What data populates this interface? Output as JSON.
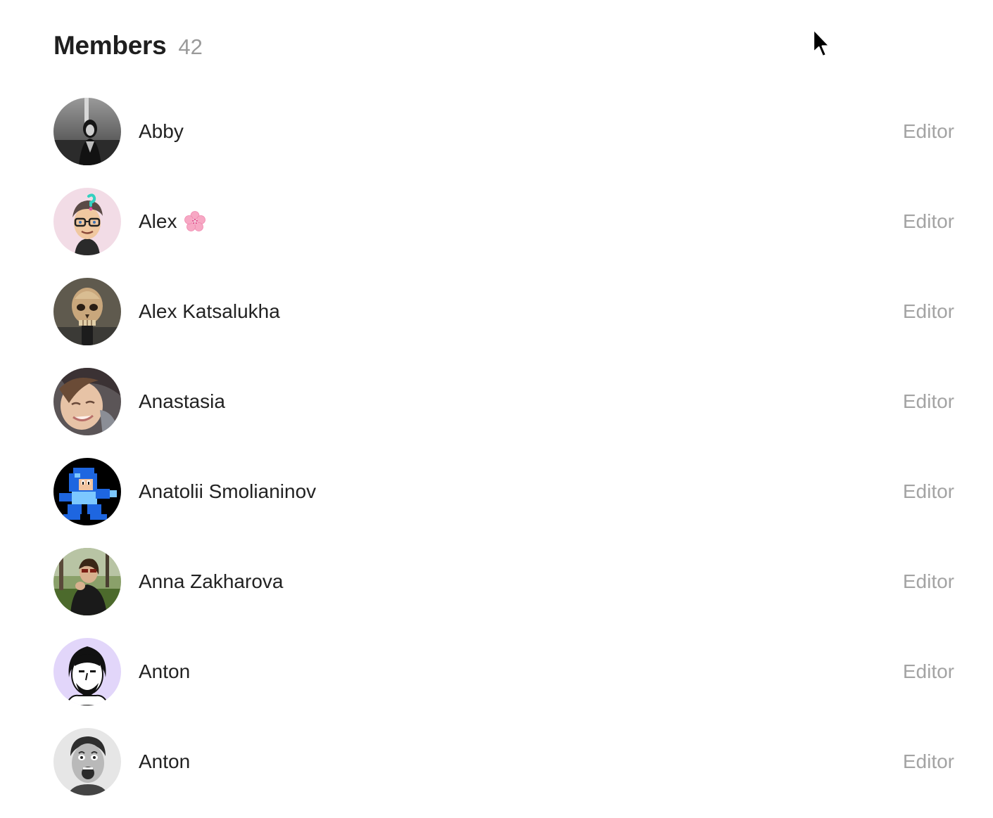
{
  "header": {
    "title": "Members",
    "count": "42"
  },
  "members": [
    {
      "name": "Abby",
      "role": "Editor",
      "avatar": "photo-woman-bw"
    },
    {
      "name": "Alex",
      "role": "Editor",
      "avatar": "cartoon-glasses",
      "name_emoji": "cherry-blossom-icon"
    },
    {
      "name": "Alex Katsalukha",
      "role": "Editor",
      "avatar": "skull-figurine"
    },
    {
      "name": "Anastasia",
      "role": "Editor",
      "avatar": "photo-smiling-face"
    },
    {
      "name": "Anatolii Smolianinov",
      "role": "Editor",
      "avatar": "pixel-robot"
    },
    {
      "name": "Anna Zakharova",
      "role": "Editor",
      "avatar": "photo-outdoor-man"
    },
    {
      "name": "Anton",
      "role": "Editor",
      "avatar": "pixel-bearded-man"
    },
    {
      "name": "Anton",
      "role": "Editor",
      "avatar": "photo-surprised-man-bw"
    }
  ],
  "colors": {
    "count_text": "#9a9a9a",
    "role_text": "#a3a3a3",
    "name_text": "#222222"
  }
}
